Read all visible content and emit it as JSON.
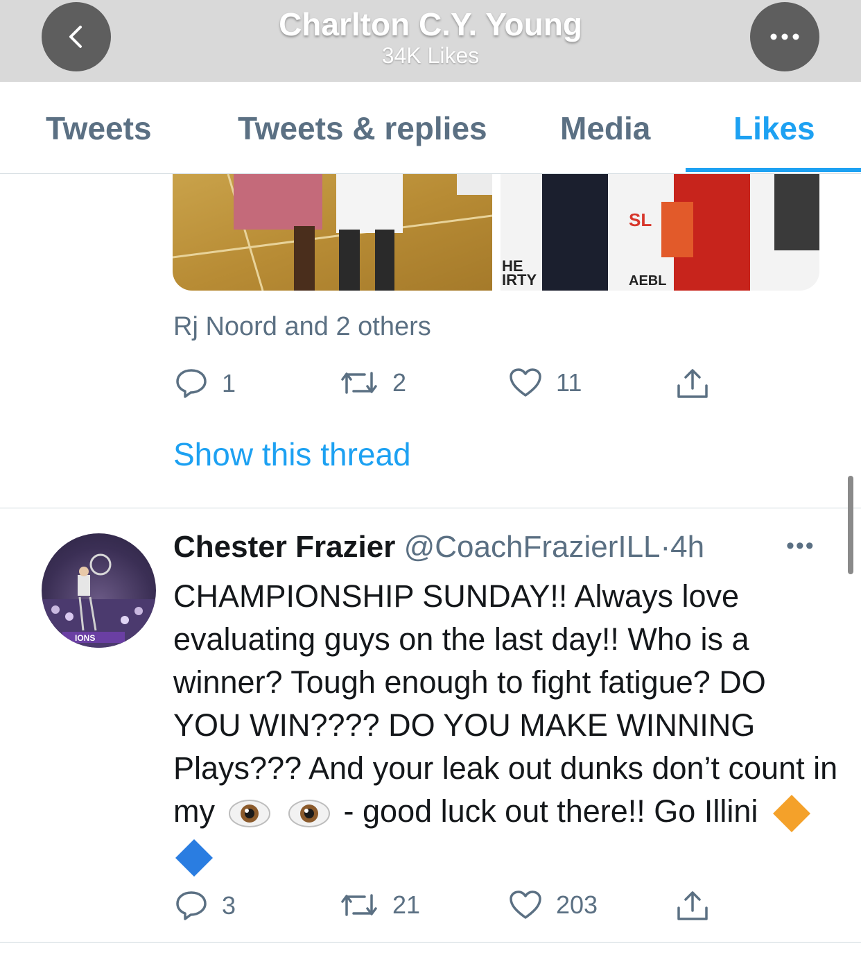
{
  "header": {
    "title": "Charlton C.Y. Young",
    "subtitle": "34K Likes",
    "back_icon": "chevron-left-icon",
    "more_icon": "more-horizontal-icon"
  },
  "tabs": [
    {
      "label": "Tweets"
    },
    {
      "label": "Tweets & replies"
    },
    {
      "label": "Media"
    },
    {
      "label": "Likes",
      "active": true
    }
  ],
  "prev_tweet": {
    "liked_by": "Rj Noord and 2 others",
    "replies": "1",
    "retweets": "2",
    "likes": "11",
    "show_thread": "Show this thread"
  },
  "tweet": {
    "name": "Chester Frazier",
    "handle": "@CoachFrazierILL",
    "separator": "·",
    "time": "4h",
    "more": "•••",
    "text_part1": "CHAMPIONSHIP SUNDAY!! Always love evaluating guys on the last day!! Who is a winner? Tough enough to fight fatigue? DO YOU WIN???? DO YOU MAKE WINNING Plays??? And your leak out dunks don’t count in my",
    "text_part2": "- good luck out there!! Go Illini",
    "replies": "3",
    "retweets": "21",
    "likes": "203"
  },
  "colors": {
    "accent": "#1da1f2",
    "muted": "#5b7083",
    "header_bg": "#d9d9d9"
  }
}
